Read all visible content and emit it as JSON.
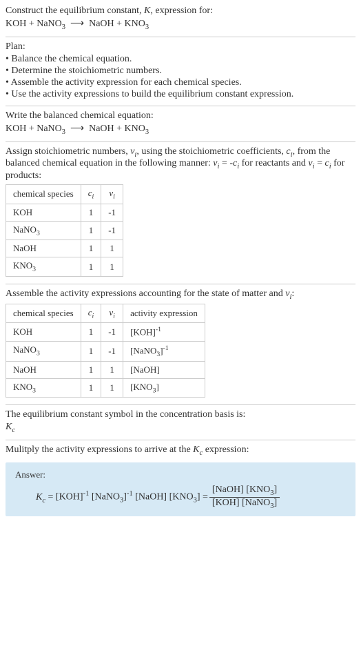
{
  "title": {
    "line1": "Construct the equilibrium constant, K, expression for:",
    "equation": "KOH + NaNO₃  ⟶  NaOH + KNO₃"
  },
  "plan": {
    "heading": "Plan:",
    "items": [
      "• Balance the chemical equation.",
      "• Determine the stoichiometric numbers.",
      "• Assemble the activity expression for each chemical species.",
      "• Use the activity expressions to build the equilibrium constant expression."
    ]
  },
  "balanced": {
    "heading": "Write the balanced chemical equation:",
    "equation": "KOH + NaNO₃  ⟶  NaOH + KNO₃"
  },
  "stoich": {
    "text1": "Assign stoichiometric numbers, νᵢ, using the stoichiometric coefficients, cᵢ, from the balanced chemical equation in the following manner: νᵢ = -cᵢ for reactants and νᵢ = cᵢ for products:"
  },
  "table1": {
    "headers": [
      "chemical species",
      "cᵢ",
      "νᵢ"
    ],
    "rows": [
      {
        "species": "KOH",
        "c": "1",
        "v": "-1"
      },
      {
        "species": "NaNO₃",
        "c": "1",
        "v": "-1"
      },
      {
        "species": "NaOH",
        "c": "1",
        "v": "1"
      },
      {
        "species": "KNO₃",
        "c": "1",
        "v": "1"
      }
    ]
  },
  "assemble": {
    "text": "Assemble the activity expressions accounting for the state of matter and νᵢ:"
  },
  "table2": {
    "headers": [
      "chemical species",
      "cᵢ",
      "νᵢ",
      "activity expression"
    ],
    "rows": [
      {
        "species": "KOH",
        "c": "1",
        "v": "-1",
        "act": "[KOH]⁻¹"
      },
      {
        "species": "NaNO₃",
        "c": "1",
        "v": "-1",
        "act": "[NaNO₃]⁻¹"
      },
      {
        "species": "NaOH",
        "c": "1",
        "v": "1",
        "act": "[NaOH]"
      },
      {
        "species": "KNO₃",
        "c": "1",
        "v": "1",
        "act": "[KNO₃]"
      }
    ]
  },
  "eqsymbol": {
    "text": "The equilibrium constant symbol in the concentration basis is:",
    "symbol": "K_c"
  },
  "multiply": {
    "text": "Mulitply the activity expressions to arrive at the K_c expression:"
  },
  "answer": {
    "label": "Answer:",
    "kc": "K_c",
    "rhs_plain": " = [KOH]⁻¹ [NaNO₃]⁻¹ [NaOH] [KNO₃] = ",
    "frac_num": "[NaOH] [KNO₃]",
    "frac_den": "[KOH] [NaNO₃]"
  }
}
